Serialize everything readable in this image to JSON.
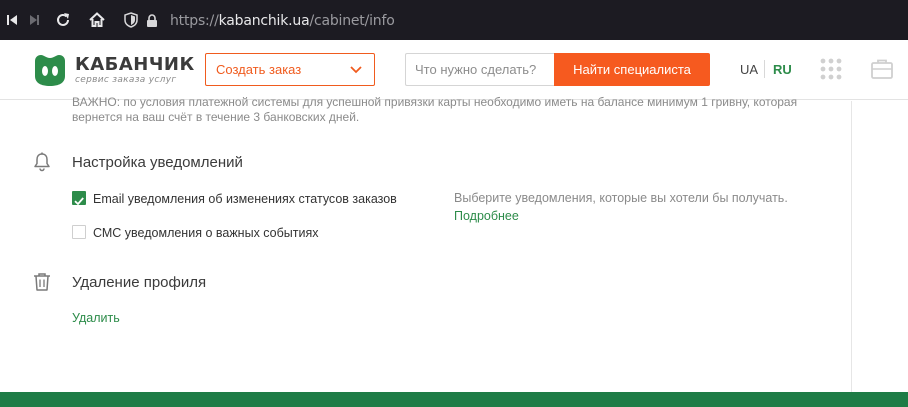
{
  "browser": {
    "url_prefix": "https://",
    "url_host": "kabanchik.ua",
    "url_path": "/cabinet/info"
  },
  "header": {
    "logo_name": "КАБАНЧИК",
    "logo_tagline": "сервис заказа услуг",
    "order_select_label": "Создать заказ",
    "search_placeholder": "Что нужно сделать?",
    "find_button": "Найти специалиста",
    "lang_ua": "UA",
    "lang_ru": "RU"
  },
  "content": {
    "notice_text": "ВАЖНО: по условия платежной системы для успешной привязки карты необходимо иметь на балансе минимум 1 гривну, которая вернется на ваш счёт в течение 3 банковских дней.",
    "notifications": {
      "title": "Настройка уведомлений",
      "email_label": "Email уведомления об изменениях статусов заказов",
      "email_checked": true,
      "sms_label": "СМС уведомления о важных событиях",
      "sms_checked": false,
      "hint": "Выберите уведомления, которые вы хотели бы получать.",
      "more_link": "Подробнее"
    },
    "delete_profile": {
      "title": "Удаление профиля",
      "delete_link": "Удалить"
    }
  },
  "colors": {
    "accent_orange": "#f65a1f",
    "brand_green": "#2d8c4a",
    "footer_green": "#1e7c46"
  },
  "icons": [
    "back-icon",
    "forward-icon",
    "reload-icon",
    "home-icon",
    "shield-icon",
    "lock-icon",
    "chevron-down-icon",
    "apps-grid-icon",
    "briefcase-icon",
    "bell-icon",
    "trash-icon",
    "checkmark-icon"
  ]
}
